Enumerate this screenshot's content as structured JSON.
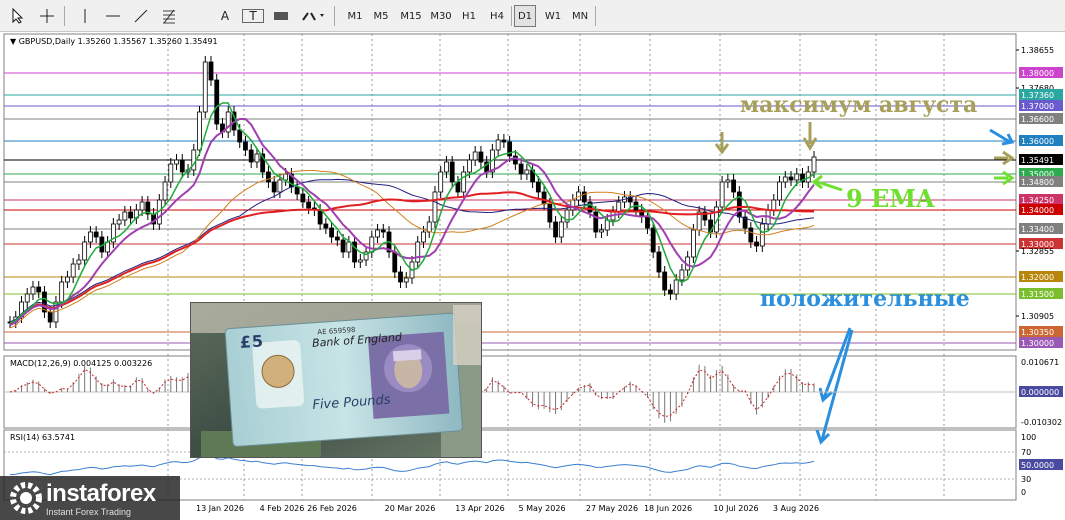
{
  "toolbar": {
    "timeframes": [
      "M1",
      "M5",
      "M15",
      "M30",
      "H1",
      "H4",
      "D1",
      "W1",
      "MN"
    ],
    "active_timeframe": "D1",
    "text_tool_label": "A",
    "text_label_tool_label": "T"
  },
  "chart": {
    "symbol_info": "GBPUSD,Daily  1.35260 1.35567 1.35260 1.35491",
    "price_labels": [
      {
        "text": "1.38655",
        "boxed": false,
        "color": ""
      },
      {
        "text": "1.38000",
        "boxed": true,
        "color": "#cc44cc"
      },
      {
        "text": "1.37680",
        "boxed": false,
        "color": ""
      },
      {
        "text": "1.37360",
        "boxed": true,
        "color": "#2aa7a0"
      },
      {
        "text": "1.37000",
        "boxed": true,
        "color": "#6a5acd"
      },
      {
        "text": "1.36600",
        "boxed": true,
        "color": "#808080"
      },
      {
        "text": "1.36000",
        "boxed": true,
        "color": "#1f7fbf"
      },
      {
        "text": "1.35491",
        "boxed": true,
        "color": "#000000"
      },
      {
        "text": "1.35000",
        "boxed": true,
        "color": "#2eaa4f"
      },
      {
        "text": "1.34800",
        "boxed": true,
        "color": "#808080"
      },
      {
        "text": "1.34250",
        "boxed": true,
        "color": "#cc3366"
      },
      {
        "text": "1.34000",
        "boxed": true,
        "color": "#cc0000"
      },
      {
        "text": "1.33400",
        "boxed": true,
        "color": "#808080"
      },
      {
        "text": "1.33000",
        "boxed": true,
        "color": "#cc3333"
      },
      {
        "text": "1.32855",
        "boxed": false,
        "color": ""
      },
      {
        "text": "1.32000",
        "boxed": true,
        "color": "#b8860b"
      },
      {
        "text": "1.31500",
        "boxed": true,
        "color": "#7cbf2e"
      },
      {
        "text": "1.30905",
        "boxed": false,
        "color": ""
      },
      {
        "text": "1.30350",
        "boxed": true,
        "color": "#cc6633"
      },
      {
        "text": "1.30000",
        "boxed": true,
        "color": "#9b59b6"
      }
    ],
    "date_labels": [
      "13 Jan 2026",
      "4 Feb 2026",
      "26 Feb 2026",
      "20 Mar 2026",
      "13 Apr 2026",
      "5 May 2026",
      "27 May 2026",
      "18 Jun 2026",
      "10 Jul 2026",
      "3 Aug 2026"
    ],
    "annotation_max_august": "максимум августа",
    "annotation_ema": "9 EMA",
    "annotation_positive": "положительные"
  },
  "macd": {
    "title": "MACD(12,26,9) 0.004125 0.003226",
    "labels": [
      "0.010671",
      "0.000000",
      "-0.010302"
    ]
  },
  "rsi": {
    "title": "RSI(14) 63.5741",
    "labels": [
      "100",
      "70",
      "50.0000",
      "30",
      "0"
    ]
  },
  "brand": {
    "name": "instaforex",
    "tagline": "Instant Forex Trading"
  },
  "banknote": {
    "bank_name": "Bank of England",
    "denomination": "5",
    "words": "Five Pounds",
    "serial": "AE 659598"
  },
  "colors": {
    "bull_candle": "#000000",
    "bear_candle": "#000000",
    "ema9": "#1faa3a",
    "ma_purple": "#a040b0",
    "ma_red": "#e02020",
    "ma_navy": "#202080",
    "ma_orange": "#d08020",
    "annotation_olive": "#a8a05a",
    "annotation_green": "#70e030",
    "annotation_blue": "#2a8fdf"
  }
}
